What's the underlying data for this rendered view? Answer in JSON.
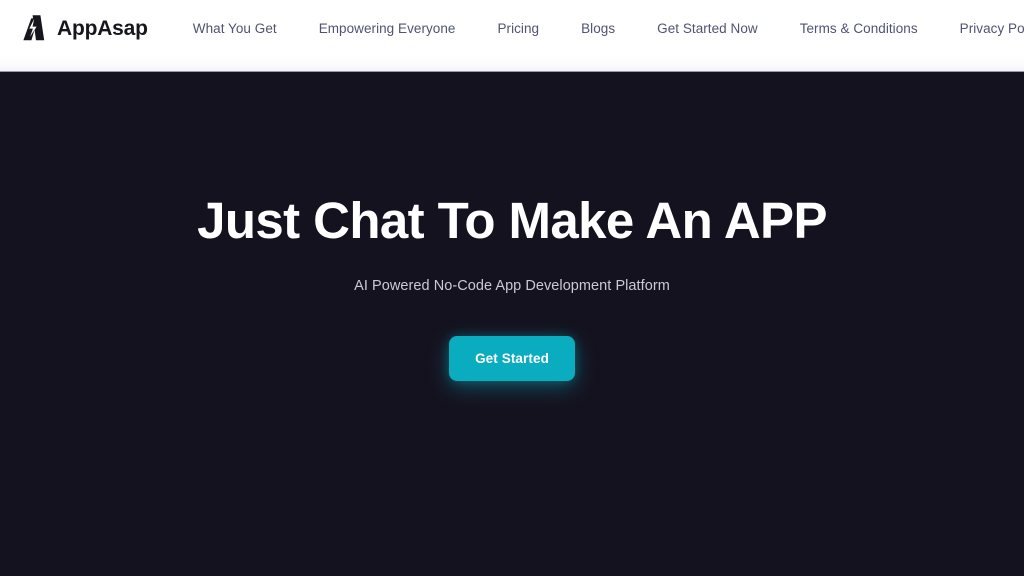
{
  "header": {
    "brand": {
      "logo_icon": "appasap-lightning-logo-icon",
      "name": "AppAsap"
    },
    "nav": [
      {
        "label": "What You Get"
      },
      {
        "label": "Empowering Everyone"
      },
      {
        "label": "Pricing"
      },
      {
        "label": "Blogs"
      },
      {
        "label": "Get Started Now"
      },
      {
        "label": "Terms & Conditions"
      },
      {
        "label": "Privacy Policy"
      }
    ],
    "background_color": "#ffffff",
    "link_color": "#4e5472",
    "brand_text_color": "#17161c"
  },
  "hero": {
    "title": "Just Chat To Make An APP",
    "subtitle": "AI Powered No-Code App Development Platform",
    "cta_label": "Get Started",
    "background_color": "#15121f",
    "title_color": "#ffffff",
    "subtitle_color": "#c9cad6",
    "accent_color": "#0aacc0"
  }
}
